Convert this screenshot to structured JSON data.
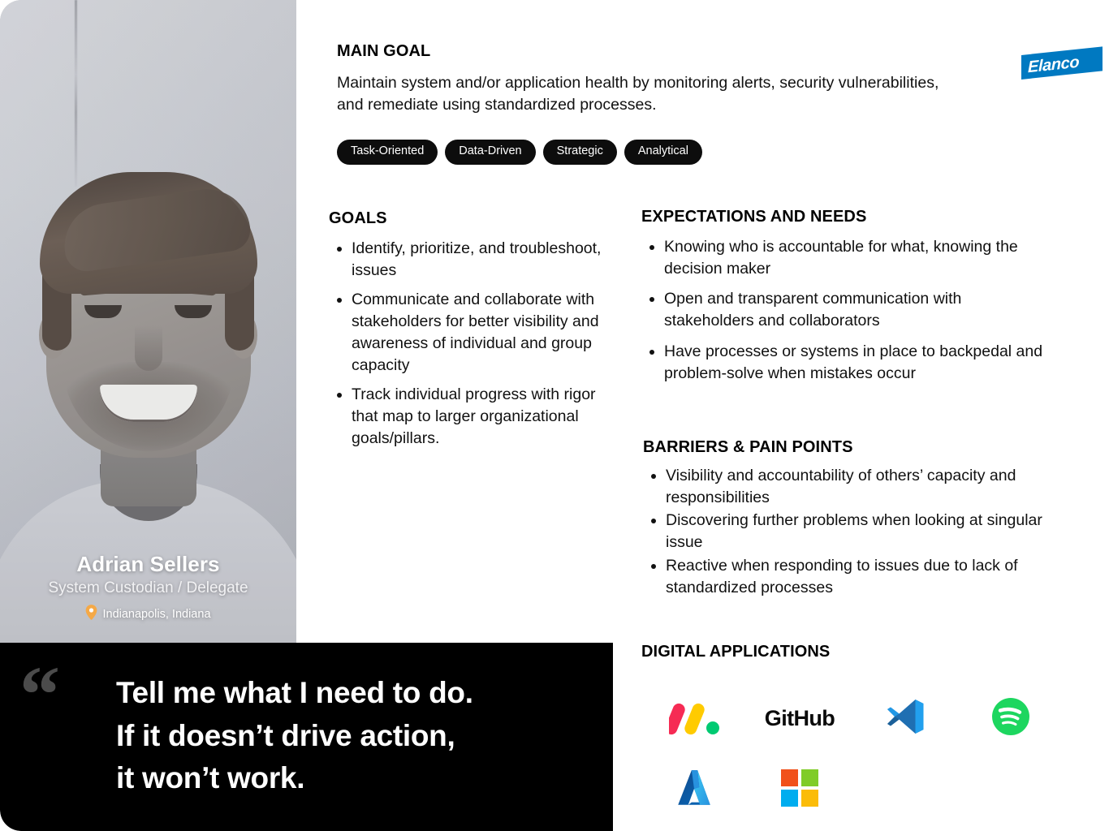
{
  "brand": {
    "name": "Elanco",
    "color": "#0079C1"
  },
  "persona": {
    "name": "Adrian Sellers",
    "role": "System Custodian / Delegate",
    "location": "Indianapolis, Indiana",
    "location_icon": "map-pin-icon",
    "pin_color": "#F5A947"
  },
  "main_goal": {
    "title": "MAIN GOAL",
    "body": "Maintain system and/or application health by monitoring alerts, security vulnerabilities, and remediate using standardized processes."
  },
  "tags": [
    "Task-Oriented",
    "Data-Driven",
    "Strategic",
    "Analytical"
  ],
  "goals": {
    "title": "GOALS",
    "items": [
      "Identify, prioritize, and troubleshoot, issues",
      "Communicate and collaborate with stakeholders for better visibility and awareness of individual and group capacity",
      "Track individual progress with rigor that map to larger organizational goals/pillars."
    ]
  },
  "expectations": {
    "title": "EXPECTATIONS AND NEEDS",
    "items": [
      "Knowing who is accountable for what, knowing the decision maker",
      "Open and transparent communication with stakeholders and collaborators",
      "Have processes or systems in place to backpedal and problem-solve when mistakes occur"
    ]
  },
  "barriers": {
    "title": "BARRIERS & PAIN POINTS",
    "items": [
      "Visibility and accountability of others’ capacity and responsibilities",
      "Discovering further problems when looking at singular issue",
      "Reactive when responding to issues due to lack of standardized processes"
    ]
  },
  "digital_applications": {
    "title": "DIGITAL APPLICATIONS",
    "items": [
      {
        "name": "monday-com",
        "label": "monday.com",
        "type": "mark"
      },
      {
        "name": "github",
        "label": "GitHub",
        "type": "wordmark"
      },
      {
        "name": "vs-code",
        "label": "Visual Studio Code",
        "type": "mark"
      },
      {
        "name": "spotify",
        "label": "Spotify",
        "type": "mark"
      },
      {
        "name": "azure",
        "label": "Microsoft Azure",
        "type": "mark"
      },
      {
        "name": "microsoft",
        "label": "Microsoft",
        "type": "mark"
      }
    ],
    "colors": {
      "monday_red": "#F62B54",
      "monday_yellow": "#FFCB00",
      "monday_green": "#00CA72",
      "github_black": "#0B0B0B",
      "vscode_blue": "#22A0EE",
      "vscode_dark": "#1F6FB2",
      "spotify_green": "#1DD65F",
      "azure_dark": "#0F5FA8",
      "azure_light": "#33B3F0",
      "ms_orange": "#F1511B",
      "ms_green": "#80CC28",
      "ms_blue": "#00ADEF",
      "ms_yellow": "#FBBC09"
    }
  },
  "quote": {
    "mark": "“",
    "text": "Tell me what I need to do.\nIf it doesn’t drive action,\nit won’t work."
  }
}
